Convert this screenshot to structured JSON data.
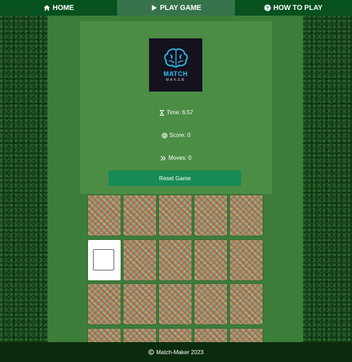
{
  "nav": {
    "home": {
      "label": "HOME",
      "icon": "home-icon"
    },
    "play": {
      "label": "PLAY GAME",
      "icon": "play-icon"
    },
    "howto": {
      "label": "HOW TO PLAY",
      "icon": "question-icon"
    }
  },
  "logo": {
    "title": "MATCH",
    "subtitle": "MAKER",
    "icon": "brain-icon"
  },
  "stats": {
    "time": "Time: 6:57",
    "score": "Score: 0",
    "moves": "Moves: 0"
  },
  "reset_label": "Reset Game",
  "grid": {
    "rows_visible": 4,
    "columns": 5,
    "flipped_card_index": 5
  },
  "footer": {
    "text": "Match-Maker 2023"
  },
  "colors": {
    "nav_bg": "#06511e",
    "nav_active": "#36734a",
    "main_bg": "#3d7d3a",
    "panel_bg": "#4b8d45",
    "button": "#178a56",
    "footer_bg": "#0b2c0c"
  }
}
